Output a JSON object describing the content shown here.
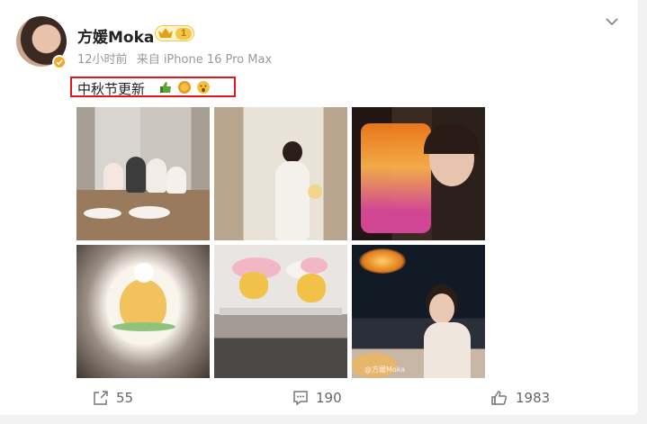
{
  "post": {
    "author": {
      "name": "方媛Moka",
      "vip_level": "1",
      "verified_icon": "verified-badge-icon"
    },
    "meta": {
      "time": "12小时前",
      "source": "来自 iPhone 16 Pro Max"
    },
    "text": "中秋节更新",
    "emojis": [
      "thumbs-up-emoji",
      "mooncake-emoji",
      "surprised-face-emoji"
    ],
    "highlight_color": "#e0161b",
    "photos": [
      {
        "name": "family-dinner-photo"
      },
      {
        "name": "woman-standing-photo"
      },
      {
        "name": "lantern-selfie-photo"
      },
      {
        "name": "cake-display-photo"
      },
      {
        "name": "rabbit-mooncakes-photo"
      },
      {
        "name": "night-view-selfie-photo"
      }
    ],
    "watermark": "@方媛Moka",
    "actions": {
      "share_count": "55",
      "comment_count": "190",
      "like_count": "1983"
    }
  },
  "colors": {
    "card_bg": "#ffffff",
    "page_bg": "#f2f2f2",
    "muted_text": "#999999",
    "vip_gold": "#f3c64a"
  }
}
